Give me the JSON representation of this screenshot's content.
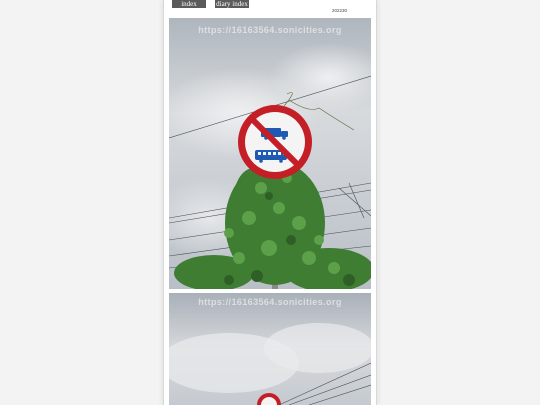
{
  "nav": {
    "index_label": "index",
    "diary_index_label": "diary index"
  },
  "date_label": "202230",
  "photos": [
    {
      "watermark": "https://16163564.sonicities.org",
      "alt": "traffic sign on vine-covered pole"
    },
    {
      "watermark": "https://16163564.sonicities.org",
      "alt": "traffic sign on vine-covered pole, second view"
    }
  ],
  "colors": {
    "sign_red": "#c41e26",
    "sign_blue": "#1e5ab4",
    "leaf": "#3f7d33",
    "sky": "#c9ced4"
  }
}
